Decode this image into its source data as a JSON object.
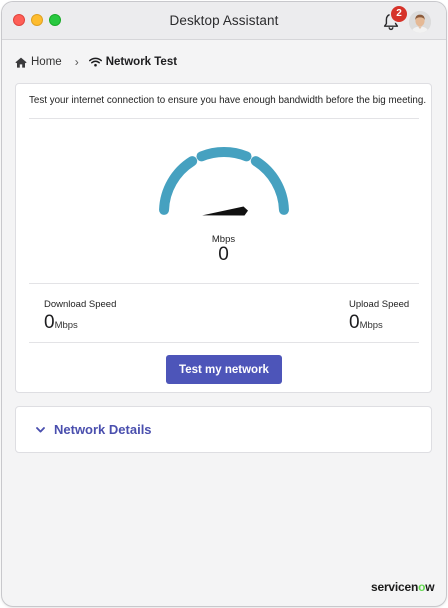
{
  "window": {
    "title": "Desktop Assistant"
  },
  "notifications": {
    "count": "2"
  },
  "breadcrumb": {
    "home": "Home",
    "current": "Network Test"
  },
  "test": {
    "intro": "Test your internet connection to ensure you have enough bandwidth before the big meeting.",
    "gauge_unit": "Mbps",
    "gauge_value": "0",
    "download": {
      "label": "Download Speed",
      "value": "0",
      "unit": "Mbps"
    },
    "upload": {
      "label": "Upload Speed",
      "value": "0",
      "unit": "Mbps"
    },
    "button": "Test my network"
  },
  "details": {
    "title": "Network Details"
  },
  "brand": {
    "prefix": "servicen",
    "accent": "o",
    "suffix": "w"
  },
  "colors": {
    "gauge_arc": "#46a1c0",
    "needle": "#111111",
    "button": "#4d55b9",
    "details_title": "#4a4fae",
    "badge": "#d6332a",
    "brand_accent": "#62d84e"
  },
  "icons": {
    "bell": "bell-icon",
    "home": "home-icon",
    "wifi": "wifi-icon",
    "chevron": "chevron-down-icon"
  }
}
